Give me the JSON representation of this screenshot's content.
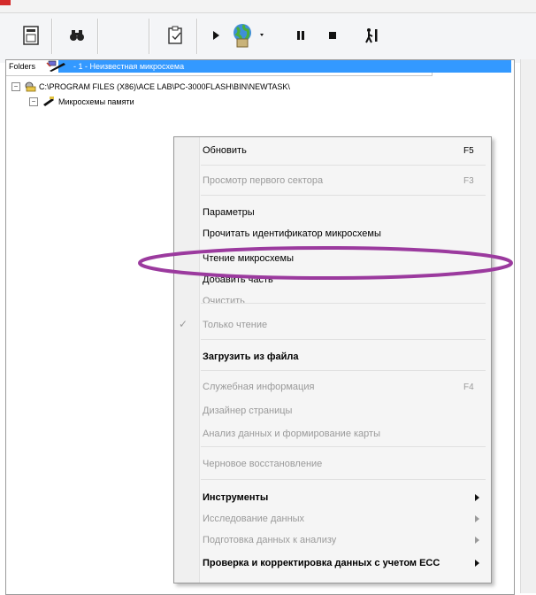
{
  "toolbar": {
    "buttons": [
      {
        "name": "device-icon"
      },
      {
        "name": "binoculars-icon"
      },
      {
        "name": "clipboard-icon"
      },
      {
        "name": "play-icon"
      },
      {
        "name": "globe-icon"
      },
      {
        "name": "pause-icon"
      },
      {
        "name": "stop-icon"
      },
      {
        "name": "step-icon"
      }
    ]
  },
  "tree": {
    "header": "Folders",
    "root_path": "C:\\PROGRAM FILES (X86)\\ACE LAB\\PC-3000FLASH\\BIN\\NEWTASK\\",
    "group": "Микросхемы памяти",
    "selected_item": "- 1 - Неизвестная микросхема"
  },
  "context_menu": {
    "items": [
      {
        "label": "Обновить",
        "shortcut": "F5",
        "disabled": false
      },
      {
        "label": "Просмотр первого сектора",
        "shortcut": "F3",
        "disabled": true
      },
      {
        "label": "Параметры",
        "shortcut": "",
        "disabled": false
      },
      {
        "label": "Прочитать идентификатор микросхемы",
        "shortcut": "",
        "disabled": false
      },
      {
        "label": "Чтение микросхемы",
        "shortcut": "",
        "disabled": false
      },
      {
        "label": "Добавить часть",
        "shortcut": "",
        "disabled": false
      },
      {
        "label": "Очистить",
        "shortcut": "",
        "disabled": true
      },
      {
        "label": "Только чтение",
        "shortcut": "",
        "disabled": true,
        "checked": true
      },
      {
        "label": "Загрузить из файла",
        "shortcut": "",
        "disabled": false
      },
      {
        "label": "Служебная информация",
        "shortcut": "F4",
        "disabled": true
      },
      {
        "label": "Дизайнер страницы",
        "shortcut": "",
        "disabled": true
      },
      {
        "label": "Анализ данных и формирование карты",
        "shortcut": "",
        "disabled": true
      },
      {
        "label": "Черновое восстановление",
        "shortcut": "",
        "disabled": true
      },
      {
        "label": "Инструменты",
        "shortcut": "",
        "disabled": false,
        "submenu": true
      },
      {
        "label": "Исследование данных",
        "shortcut": "",
        "disabled": true,
        "submenu": true
      },
      {
        "label": "Подготовка данных к анализу",
        "shortcut": "",
        "disabled": true,
        "submenu": true
      },
      {
        "label": "Проверка и корректировка данных с учетом ECC",
        "shortcut": "",
        "disabled": false,
        "submenu": true
      }
    ]
  },
  "colors": {
    "selection": "#3399ff",
    "highlight_ellipse": "#9b3a9e",
    "disabled_text": "#9a9a9a"
  }
}
